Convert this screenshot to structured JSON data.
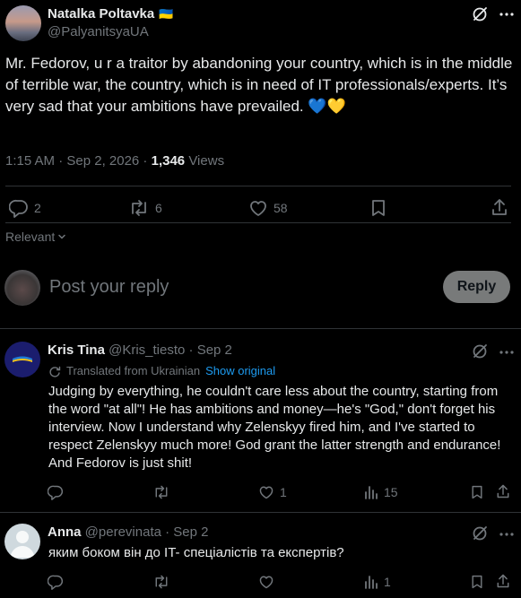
{
  "main_tweet": {
    "author_name": "Natalka Poltavka",
    "author_flag": "🇺🇦",
    "handle": "@PalyanitsyaUA",
    "text": "Mr. Fedorov, u  r a traitor by abandoning your country, which is in the middle of terrible war, the country, which is in need of IT professionals/experts. It’s very sad that your ambitions have prevailed. 💙💛",
    "timestamp": "1:15 AM · Sep 2, 2026 · ",
    "views_count": "1,346",
    "views_label": " Views",
    "replies": "2",
    "reposts": "6",
    "likes": "58"
  },
  "sort": {
    "label": "Relevant"
  },
  "composer": {
    "placeholder": "Post your reply",
    "button": "Reply"
  },
  "replies": [
    {
      "author_name": "Kris Tina",
      "handle": "@Kris_tiesto",
      "date": "· Sep 2",
      "translated_label": "Translated from Ukrainian",
      "show_original": "Show original",
      "text": "Judging by everything, he couldn't care less about the country, starting from the word \"at all\"! He has ambitions and money—he's \"God,\" don't forget his interview. Now I understand why Zelenskyy fired him, and I've started to respect Zelenskyy much more! God grant the latter strength and endurance! And Fedorov is just shit!",
      "replies": "",
      "reposts": "",
      "likes": "1",
      "views": "15"
    },
    {
      "author_name": "Anna",
      "handle": "@perevinata",
      "date": "· Sep 2",
      "text": "яким боком він до IT- спеціалістів та експертів?",
      "replies": "",
      "reposts": "",
      "likes": "",
      "views": "1"
    }
  ]
}
